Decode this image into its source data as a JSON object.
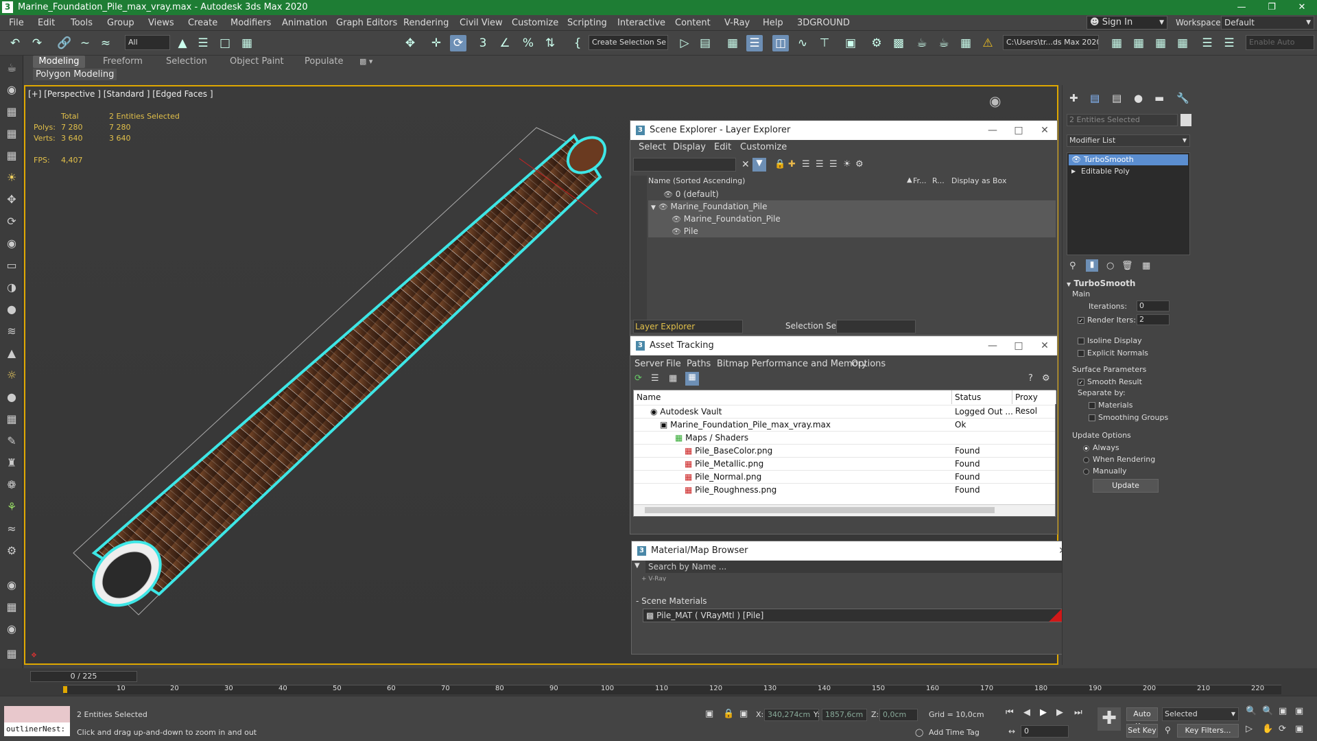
{
  "window": {
    "title": "Marine_Foundation_Pile_max_vray.max - Autodesk 3ds Max 2020"
  },
  "menu": [
    "File",
    "Edit",
    "Tools",
    "Group",
    "Views",
    "Create",
    "Modifiers",
    "Animation",
    "Graph Editors",
    "Rendering",
    "Civil View",
    "Customize",
    "Scripting",
    "Interactive",
    "Content",
    "V-Ray",
    "Help",
    "3DGROUND"
  ],
  "account": {
    "sign_in": "Sign In",
    "workspaces_label": "Workspaces:",
    "workspace": "Default"
  },
  "toolbar": {
    "filter": "All",
    "selection_set": "Create Selection Se",
    "path": "C:\\Users\\tr...ds Max 2020",
    "enable_auto": "Enable Auto"
  },
  "ribbon": {
    "tabs": [
      "Modeling",
      "Freeform",
      "Selection",
      "Object Paint",
      "Populate"
    ],
    "sub": "Polygon Modeling"
  },
  "viewport": {
    "label": "[+] [Perspective ] [Standard ] [Edged Faces ]",
    "stats": {
      "total_label": "Total",
      "selected_label": "2 Entities Selected",
      "polys_label": "Polys:",
      "polys_total": "7 280",
      "polys_sel": "7 280",
      "verts_label": "Verts:",
      "verts_total": "3 640",
      "verts_sel": "3 640",
      "fps_label": "FPS:",
      "fps": "4,407"
    }
  },
  "scene_explorer": {
    "title": "Scene Explorer - Layer Explorer",
    "menu": [
      "Select",
      "Display",
      "Edit",
      "Customize"
    ],
    "columns": [
      "Name (Sorted Ascending)",
      "Fr...",
      "R...",
      "Display as Box"
    ],
    "rows": [
      "0 (default)",
      "Marine_Foundation_Pile",
      "Marine_Foundation_Pile",
      "Pile"
    ],
    "footer_mode": "Layer Explorer",
    "selection_set_label": "Selection Set:"
  },
  "asset_tracking": {
    "title": "Asset Tracking",
    "menu": [
      "Server",
      "File",
      "Paths",
      "Bitmap Performance and Memory",
      "Options"
    ],
    "columns": [
      "Name",
      "Status",
      "Proxy Resol"
    ],
    "rows": [
      {
        "name": "Autodesk Vault",
        "status": "Logged Out ..."
      },
      {
        "name": "Marine_Foundation_Pile_max_vray.max",
        "status": "Ok"
      },
      {
        "name": "Maps / Shaders",
        "status": ""
      },
      {
        "name": "Pile_BaseColor.png",
        "status": "Found"
      },
      {
        "name": "Pile_Metallic.png",
        "status": "Found"
      },
      {
        "name": "Pile_Normal.png",
        "status": "Found"
      },
      {
        "name": "Pile_Roughness.png",
        "status": "Found"
      }
    ]
  },
  "material_browser": {
    "title": "Material/Map Browser",
    "search_placeholder": "Search by Name ...",
    "group_partial": "+ V-Ray",
    "section": "- Scene Materials",
    "material": "Pile_MAT  ( VRayMtl )  [Pile]"
  },
  "command_panel": {
    "selection_name": "2 Entities Selected",
    "modifier_list": "Modifier List",
    "stack": [
      "TurboSmooth",
      "Editable Poly"
    ],
    "rollout_title": "TurboSmooth",
    "main_label": "Main",
    "iterations_label": "Iterations:",
    "iterations": "0",
    "render_iters_label": "Render Iters:",
    "render_iters": "2",
    "isoline": "Isoline Display",
    "explicit": "Explicit Normals",
    "surface_label": "Surface Parameters",
    "smooth_result": "Smooth Result",
    "separate_by": "Separate by:",
    "materials": "Materials",
    "smoothing_groups": "Smoothing Groups",
    "update_label": "Update Options",
    "always": "Always",
    "when_rendering": "When Rendering",
    "manually": "Manually",
    "update_btn": "Update"
  },
  "timeline": {
    "frame": "0 / 225",
    "ticks": [
      "10",
      "20",
      "30",
      "40",
      "50",
      "60",
      "70",
      "80",
      "90",
      "100",
      "110",
      "120",
      "130",
      "140",
      "150",
      "160",
      "170",
      "180",
      "190",
      "200",
      "210",
      "220"
    ]
  },
  "status": {
    "script": "outlinerNest:",
    "selected": "2 Entities Selected",
    "prompt": "Click and drag up-and-down to zoom in and out",
    "x_label": "X:",
    "x": "340,274cm",
    "y_label": "Y:",
    "y": "1857,6cm",
    "z_label": "Z:",
    "z": "0,0cm",
    "grid": "Grid = 10,0cm",
    "add_time_tag": "Add Time Tag",
    "auto_key": "Auto Key",
    "auto_key_mode": "Selected",
    "set_key": "Set Key",
    "key_filters": "Key Filters...",
    "frame_field": "0"
  },
  "colors": {
    "title_bar": "#1e7d34",
    "accent": "#6d8fb5",
    "viewport_border": "#e0a800",
    "selection_cyan": "#3ee6e6",
    "stats_text": "#e2c04a"
  }
}
